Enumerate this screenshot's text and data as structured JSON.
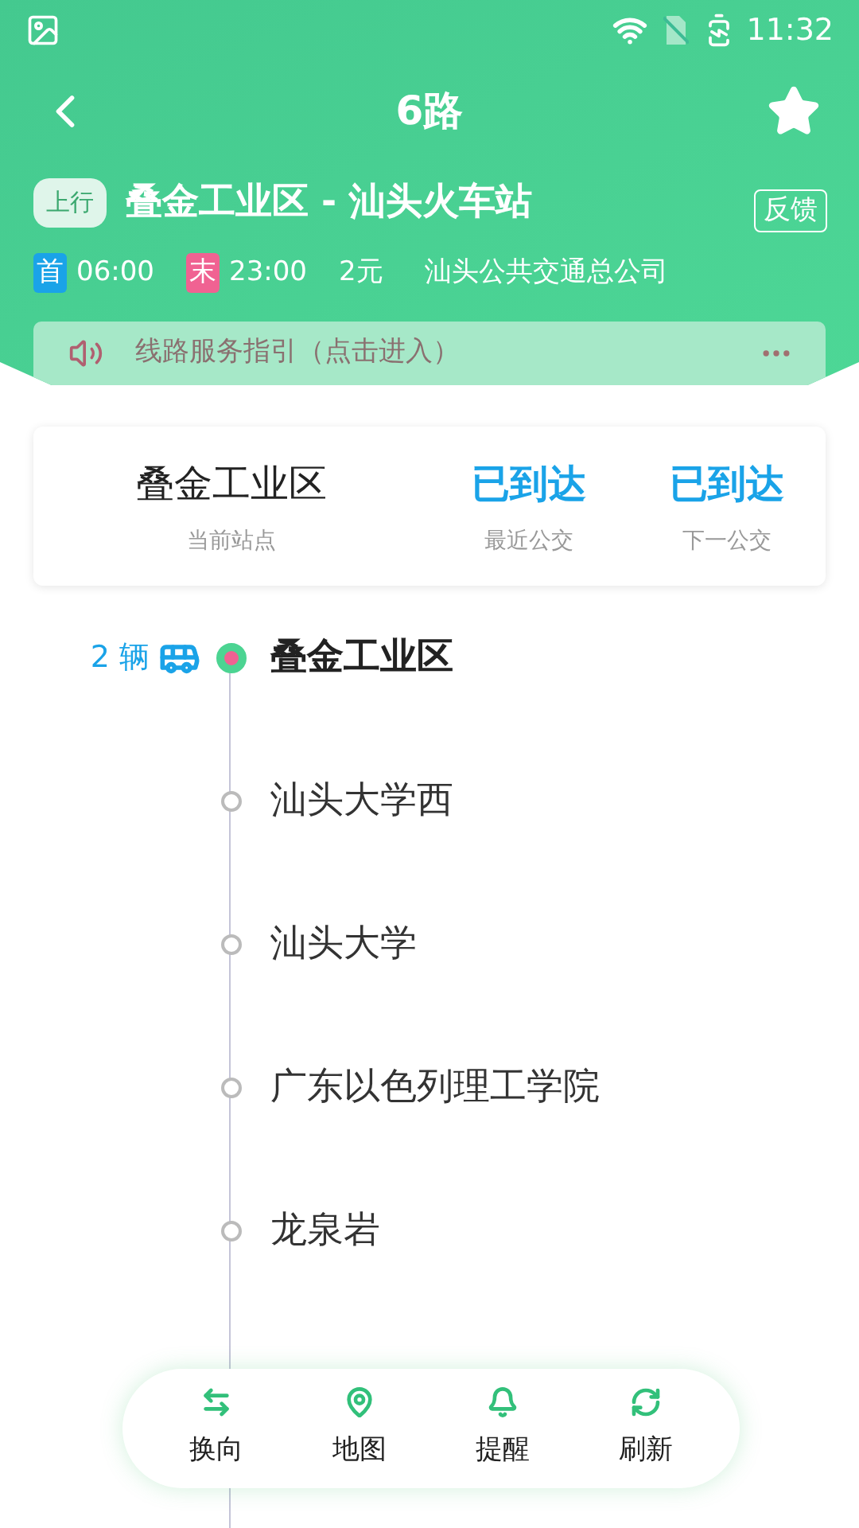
{
  "status_bar": {
    "time": "11:32"
  },
  "header": {
    "title": "6路",
    "favorite": true
  },
  "route": {
    "direction": "上行",
    "name": "叠金工业区 - 汕头火车站",
    "feedback": "反馈"
  },
  "info": {
    "first_label": "首",
    "first_time": "06:00",
    "last_label": "末",
    "last_time": "23:00",
    "fare": "2元",
    "operator": "汕头公共交通总公司"
  },
  "notice": {
    "text": "线路服务指引（点击进入）"
  },
  "summary": [
    {
      "value": "叠金工业区",
      "label": "当前站点",
      "kind": "station"
    },
    {
      "value": "已到达",
      "label": "最近公交",
      "kind": "bus"
    },
    {
      "value": "已到达",
      "label": "下一公交",
      "kind": "bus"
    }
  ],
  "stations": [
    {
      "name": "叠金工业区",
      "selected": true,
      "buses": "2 辆"
    },
    {
      "name": "汕头大学西",
      "selected": false
    },
    {
      "name": "汕头大学",
      "selected": false
    },
    {
      "name": "广东以色列理工学院",
      "selected": false
    },
    {
      "name": "龙泉岩",
      "selected": false
    }
  ],
  "toolbar": [
    {
      "label": "换向",
      "kind": "swap"
    },
    {
      "label": "地图",
      "kind": "map"
    },
    {
      "label": "提醒",
      "kind": "bell"
    },
    {
      "label": "刷新",
      "kind": "refresh"
    }
  ]
}
